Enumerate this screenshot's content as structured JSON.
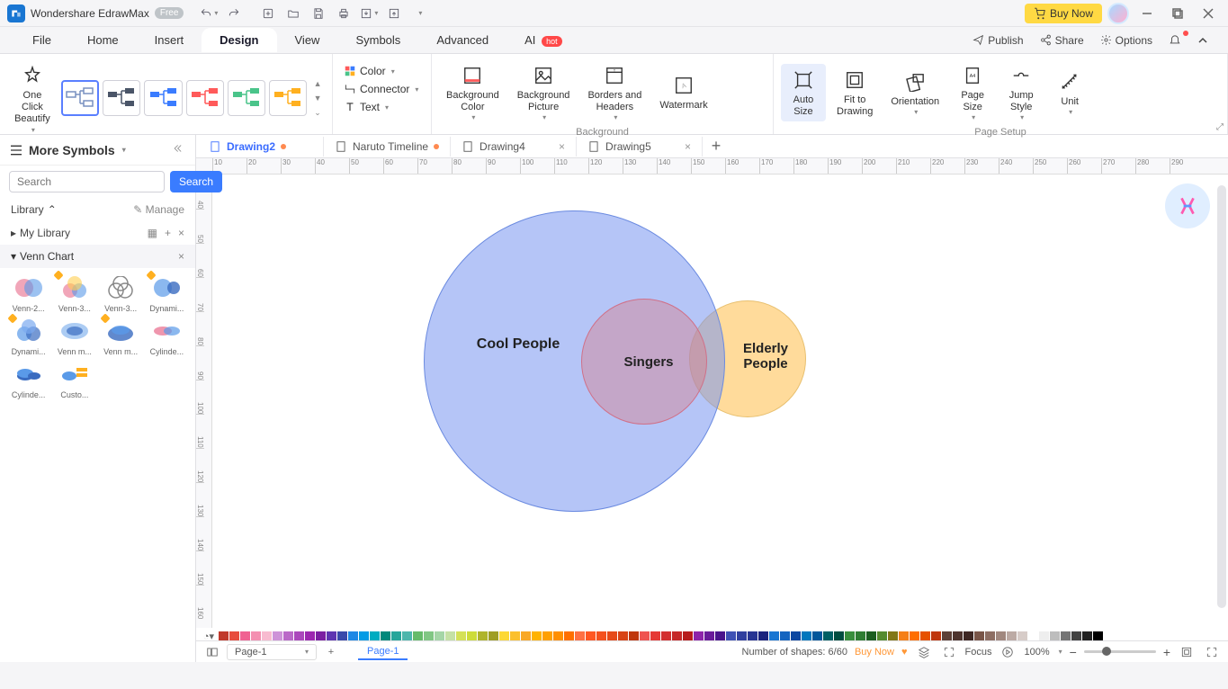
{
  "titlebar": {
    "app_name": "Wondershare EdrawMax",
    "free_badge": "Free",
    "buy_now": "Buy Now"
  },
  "menubar": {
    "items": [
      "File",
      "Home",
      "Insert",
      "Design",
      "View",
      "Symbols",
      "Advanced"
    ],
    "ai_label": "AI",
    "ai_badge": "hot",
    "publish": "Publish",
    "share": "Share",
    "options": "Options"
  },
  "ribbon": {
    "oneclick": "One Click\nBeautify",
    "beautify_label": "Beautify",
    "color": "Color",
    "connector": "Connector",
    "text": "Text",
    "bg_color": "Background\nColor",
    "bg_picture": "Background\nPicture",
    "borders": "Borders and\nHeaders",
    "watermark": "Watermark",
    "background_label": "Background",
    "auto_size": "Auto\nSize",
    "fit_drawing": "Fit to\nDrawing",
    "orientation": "Orientation",
    "page_size": "Page\nSize",
    "jump_style": "Jump\nStyle",
    "unit": "Unit",
    "page_setup_label": "Page Setup"
  },
  "tabs": [
    {
      "label": "Drawing2",
      "modified": true,
      "active": true
    },
    {
      "label": "Naruto Timeline",
      "modified": true,
      "active": false
    },
    {
      "label": "Drawing4",
      "modified": false,
      "active": false
    },
    {
      "label": "Drawing5",
      "modified": false,
      "active": false
    }
  ],
  "sidebar": {
    "title": "More Symbols",
    "search_placeholder": "Search",
    "search_btn": "Search",
    "library": "Library",
    "manage": "Manage",
    "my_library": "My Library",
    "venn_section": "Venn Chart",
    "items": [
      "Venn-2...",
      "Venn-3...",
      "Venn-3...",
      "Dynami...",
      "Dynami...",
      "Venn m...",
      "Venn m...",
      "Cylinde...",
      "Cylinde...",
      "Custo..."
    ]
  },
  "ruler_h": [
    "10",
    "20",
    "30",
    "40",
    "50",
    "60",
    "70",
    "80",
    "90",
    "100",
    "110",
    "120",
    "130",
    "140",
    "150",
    "160",
    "170",
    "180",
    "190",
    "200",
    "210",
    "220",
    "230",
    "240",
    "250",
    "260",
    "270",
    "280",
    "290"
  ],
  "ruler_v": [
    "40",
    "50",
    "60",
    "70",
    "80",
    "90",
    "100",
    "110",
    "120",
    "130",
    "140",
    "150",
    "160"
  ],
  "venn": {
    "big": "Cool People",
    "mid": "Singers",
    "small": "Elderly\nPeople"
  },
  "status": {
    "page_sel": "Page-1",
    "page_tab": "Page-1",
    "shapes": "Number of shapes: 6/60",
    "buy_now": "Buy Now",
    "focus": "Focus",
    "zoom": "100%"
  },
  "swatch_colors": [
    "#c0392b",
    "#e74c3c",
    "#f06292",
    "#f48fb1",
    "#f8bbd0",
    "#ce93d8",
    "#ba68c8",
    "#ab47bc",
    "#9c27b0",
    "#7b1fa2",
    "#5e35b1",
    "#3949ab",
    "#1e88e5",
    "#039be5",
    "#00acc1",
    "#00897b",
    "#26a69a",
    "#4db6ac",
    "#66bb6a",
    "#81c784",
    "#a5d6a7",
    "#c5e1a5",
    "#d4e157",
    "#cddc39",
    "#afb42b",
    "#9e9d24",
    "#fdd835",
    "#fbc02d",
    "#f9a825",
    "#ffb300",
    "#ffa000",
    "#ff8f00",
    "#ff6f00",
    "#ff7043",
    "#ff5722",
    "#f4511e",
    "#e64a19",
    "#d84315",
    "#bf360c",
    "#ef5350",
    "#e53935",
    "#d32f2f",
    "#c62828",
    "#b71c1c",
    "#8e24aa",
    "#6a1b9a",
    "#4a148c",
    "#3f51b5",
    "#303f9f",
    "#283593",
    "#1a237e",
    "#1976d2",
    "#1565c0",
    "#0d47a1",
    "#0277bd",
    "#01579b",
    "#006064",
    "#004d40",
    "#388e3c",
    "#2e7d32",
    "#1b5e20",
    "#558b2f",
    "#827717",
    "#f57f17",
    "#ff6f00",
    "#e65100",
    "#bf360c",
    "#5d4037",
    "#4e342e",
    "#3e2723",
    "#795548",
    "#8d6e63",
    "#a1887f",
    "#bcaaa4",
    "#d7ccc8",
    "#ffffff",
    "#eeeeee",
    "#bdbdbd",
    "#757575",
    "#424242",
    "#212121",
    "#000000"
  ]
}
